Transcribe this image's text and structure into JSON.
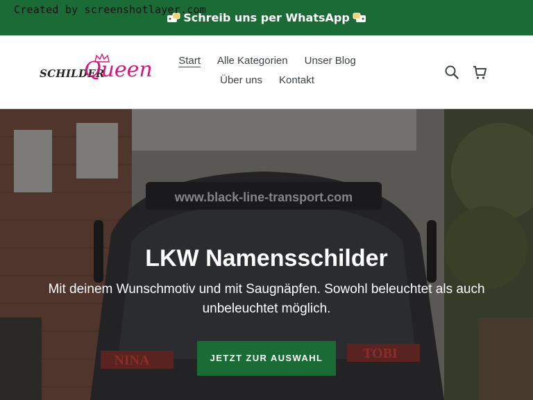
{
  "watermark": "Created by screenshotlayer.com",
  "announcement": {
    "text": "Schreib uns per WhatsApp",
    "icon_left": "whatsapp-emoji-icon",
    "icon_right": "whatsapp-emoji-icon"
  },
  "logo": {
    "part1": "SCHILDER",
    "part2": "Queen"
  },
  "nav": {
    "row1": [
      {
        "label": "Start",
        "active": true
      },
      {
        "label": "Alle Kategorien",
        "active": false
      },
      {
        "label": "Unser Blog",
        "active": false
      }
    ],
    "row2": [
      {
        "label": "Über uns",
        "active": false
      },
      {
        "label": "Kontakt",
        "active": false
      }
    ]
  },
  "header_icons": {
    "search": "search-icon",
    "cart": "cart-icon"
  },
  "hero": {
    "title": "LKW Namensschilder",
    "subtitle": "Mit deinem Wunschmotiv und mit Saugnäpfen. Sowohl beleuchtet als auch unbeleuchtet möglich.",
    "button_label": "JETZT ZUR AUSWAHL",
    "truck_banner": "www.black-line-transport.com",
    "sign_left": "NINA",
    "sign_right": "TOBI"
  },
  "colors": {
    "brand_green": "#1b6b36",
    "logo_pink": "#d6147f",
    "nav_text": "#3d4246"
  }
}
